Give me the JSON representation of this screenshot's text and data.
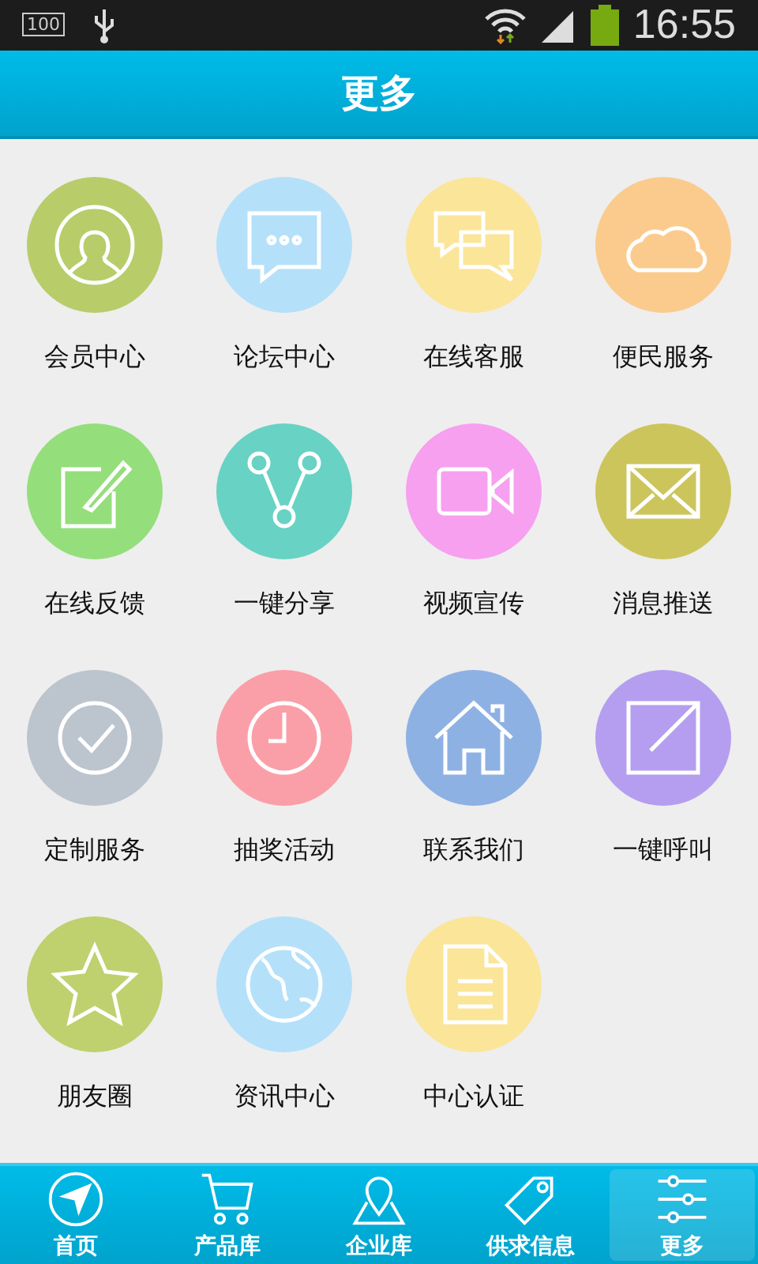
{
  "status_bar": {
    "battery_level_text": "100",
    "time": "16:55"
  },
  "header": {
    "title": "更多"
  },
  "grid": [
    {
      "label": "会员中心",
      "kind": "person",
      "color": "#b8cc6a"
    },
    {
      "label": "论坛中心",
      "kind": "chat",
      "color": "#b4e0fa"
    },
    {
      "label": "在线客服",
      "kind": "chats",
      "color": "#fbe598"
    },
    {
      "label": "便民服务",
      "kind": "cloud",
      "color": "#fbcb8e"
    },
    {
      "label": "在线反馈",
      "kind": "edit",
      "color": "#94de7c"
    },
    {
      "label": "一键分享",
      "kind": "share",
      "color": "#68d2c4"
    },
    {
      "label": "视频宣传",
      "kind": "video",
      "color": "#f6a0ef"
    },
    {
      "label": "消息推送",
      "kind": "mail",
      "color": "#ccc55c"
    },
    {
      "label": "定制服务",
      "kind": "check",
      "color": "#bcc4ce"
    },
    {
      "label": "抽奖活动",
      "kind": "clock",
      "color": "#fa9fa8"
    },
    {
      "label": "联系我们",
      "kind": "home",
      "color": "#8eb1e4"
    },
    {
      "label": "一键呼叫",
      "kind": "arrow",
      "color": "#b59ef0"
    },
    {
      "label": "朋友圈",
      "kind": "star",
      "color": "#bfd06e"
    },
    {
      "label": "资讯中心",
      "kind": "globe",
      "color": "#b4e0fa"
    },
    {
      "label": "中心认证",
      "kind": "doc",
      "color": "#fbe598"
    }
  ],
  "tabs": [
    {
      "label": "首页",
      "kind": "compass",
      "selected": false
    },
    {
      "label": "产品库",
      "kind": "cart",
      "selected": false
    },
    {
      "label": "企业库",
      "kind": "map",
      "selected": false
    },
    {
      "label": "供求信息",
      "kind": "tag",
      "selected": false
    },
    {
      "label": "更多",
      "kind": "sliders",
      "selected": true
    }
  ]
}
